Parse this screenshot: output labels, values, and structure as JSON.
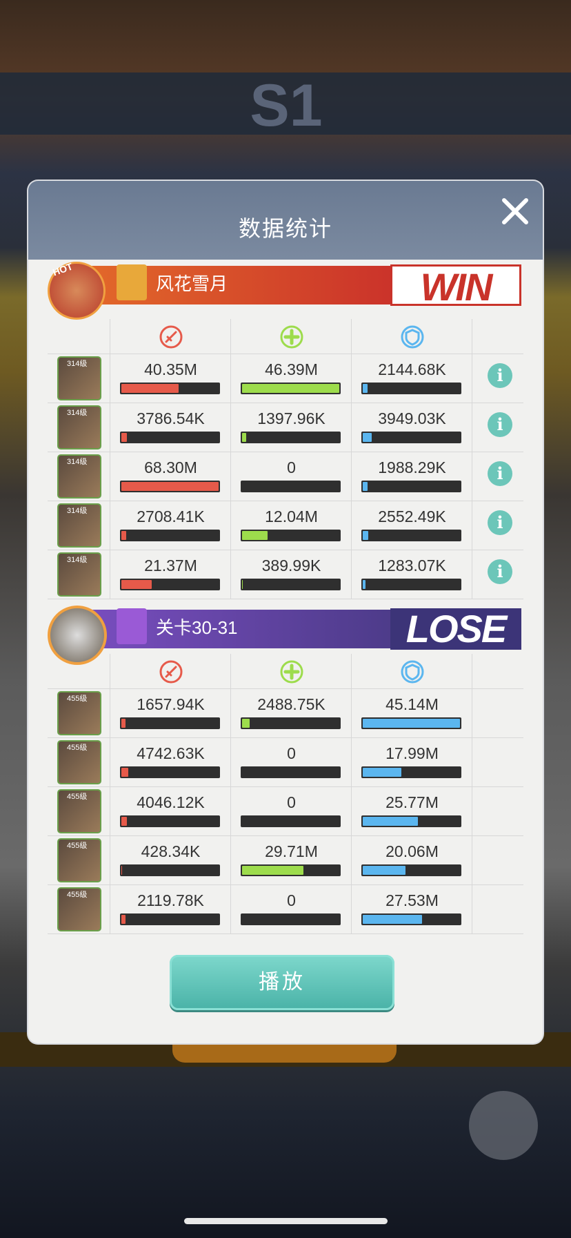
{
  "modal": {
    "title": "数据统计"
  },
  "colors": {
    "damage": "#e65a4a",
    "heal": "#9ddc4c",
    "tank": "#5bb6ef",
    "win_red": "#c9332a",
    "lose_purple": "#4a3a86"
  },
  "icons": {
    "damage": "damage-icon",
    "heal": "heal-icon",
    "tank": "shield-icon",
    "close": "close-icon",
    "info": "info-icon"
  },
  "team1": {
    "name": "风花雪月",
    "result": "WIN",
    "hot_badge": "HOT",
    "rows": [
      {
        "level": "314级",
        "dmg": "40.35M",
        "dmg_frac": 0.59,
        "heal": "46.39M",
        "heal_frac": 1.0,
        "tank": "2144.68K",
        "tank_frac": 0.05
      },
      {
        "level": "314级",
        "dmg": "3786.54K",
        "dmg_frac": 0.06,
        "heal": "1397.96K",
        "heal_frac": 0.04,
        "tank": "3949.03K",
        "tank_frac": 0.09
      },
      {
        "level": "314级",
        "dmg": "68.30M",
        "dmg_frac": 1.0,
        "heal": "0",
        "heal_frac": 0,
        "tank": "1988.29K",
        "tank_frac": 0.05
      },
      {
        "level": "314级",
        "dmg": "2708.41K",
        "dmg_frac": 0.05,
        "heal": "12.04M",
        "heal_frac": 0.26,
        "tank": "2552.49K",
        "tank_frac": 0.06
      },
      {
        "level": "314级",
        "dmg": "21.37M",
        "dmg_frac": 0.31,
        "heal": "389.99K",
        "heal_frac": 0.01,
        "tank": "1283.07K",
        "tank_frac": 0.03
      }
    ]
  },
  "team2": {
    "name": "关卡30-31",
    "result": "LOSE",
    "rows": [
      {
        "level": "455级",
        "dmg": "1657.94K",
        "dmg_frac": 0.04,
        "heal": "2488.75K",
        "heal_frac": 0.08,
        "tank": "45.14M",
        "tank_frac": 1.0
      },
      {
        "level": "455级",
        "dmg": "4742.63K",
        "dmg_frac": 0.07,
        "heal": "0",
        "heal_frac": 0,
        "tank": "17.99M",
        "tank_frac": 0.4
      },
      {
        "level": "455级",
        "dmg": "4046.12K",
        "dmg_frac": 0.06,
        "heal": "0",
        "heal_frac": 0,
        "tank": "25.77M",
        "tank_frac": 0.57
      },
      {
        "level": "455级",
        "dmg": "428.34K",
        "dmg_frac": 0.01,
        "heal": "29.71M",
        "heal_frac": 0.63,
        "tank": "20.06M",
        "tank_frac": 0.44
      },
      {
        "level": "455级",
        "dmg": "2119.78K",
        "dmg_frac": 0.04,
        "heal": "0",
        "heal_frac": 0,
        "tank": "27.53M",
        "tank_frac": 0.61
      }
    ]
  },
  "play_button": "播放",
  "background": {
    "round_label": "S1"
  }
}
